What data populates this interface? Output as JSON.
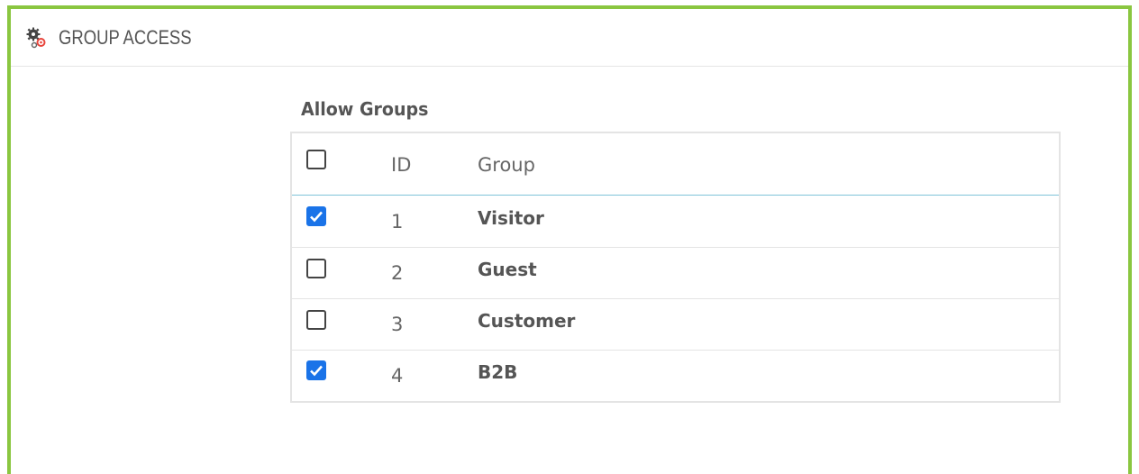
{
  "panel": {
    "title": "GROUP ACCESS",
    "icon": "gears-icon",
    "accent_color": "#8ac640"
  },
  "section": {
    "label": "Allow Groups"
  },
  "table": {
    "columns": {
      "select_all_checked": false,
      "id": "ID",
      "group": "Group"
    },
    "rows": [
      {
        "checked": true,
        "id": "1",
        "name": "Visitor"
      },
      {
        "checked": false,
        "id": "2",
        "name": "Guest"
      },
      {
        "checked": false,
        "id": "3",
        "name": "Customer"
      },
      {
        "checked": true,
        "id": "4",
        "name": "B2B"
      }
    ],
    "checkbox_color": "#1a73e8",
    "header_border_color": "#7fc3d9"
  }
}
